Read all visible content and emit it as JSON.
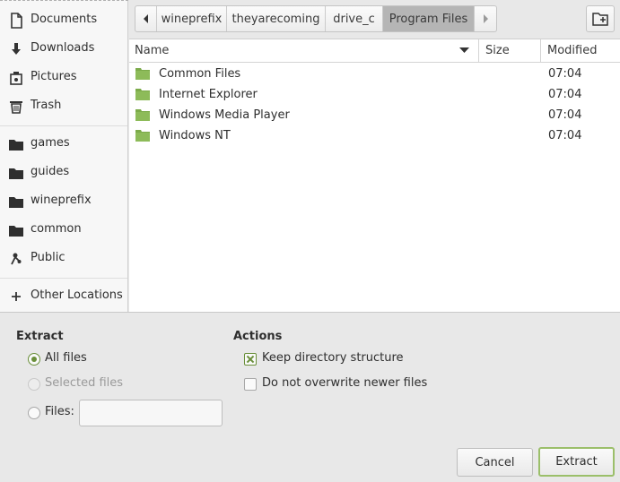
{
  "sidebar": {
    "places": [
      {
        "label": "Documents",
        "icon": "document-icon"
      },
      {
        "label": "Downloads",
        "icon": "download-icon"
      },
      {
        "label": "Pictures",
        "icon": "picture-icon"
      },
      {
        "label": "Trash",
        "icon": "trash-icon"
      }
    ],
    "bookmarks": [
      {
        "label": "games",
        "icon": "folder-icon"
      },
      {
        "label": "guides",
        "icon": "folder-icon"
      },
      {
        "label": "wineprefix",
        "icon": "folder-icon"
      },
      {
        "label": "common",
        "icon": "folder-icon"
      },
      {
        "label": "Public",
        "icon": "share-icon"
      }
    ],
    "other_locations": "Other Locations"
  },
  "pathbar": {
    "crumbs": [
      "wineprefix",
      "theyarecoming",
      "drive_c",
      "Program Files"
    ],
    "active": "Program Files"
  },
  "filelist": {
    "columns": {
      "name": "Name",
      "size": "Size",
      "modified": "Modified"
    },
    "rows": [
      {
        "name": "Common Files",
        "size": "",
        "modified": "07:04"
      },
      {
        "name": "Internet Explorer",
        "size": "",
        "modified": "07:04"
      },
      {
        "name": "Windows Media Player",
        "size": "",
        "modified": "07:04"
      },
      {
        "name": "Windows NT",
        "size": "",
        "modified": "07:04"
      }
    ]
  },
  "extract": {
    "title": "Extract",
    "all_files": "All files",
    "selected_files": "Selected files",
    "files": "Files:",
    "files_value": ""
  },
  "actions": {
    "title": "Actions",
    "keep_structure": "Keep directory structure",
    "no_overwrite": "Do not overwrite newer files"
  },
  "buttons": {
    "cancel": "Cancel",
    "extract": "Extract"
  },
  "colors": {
    "accent": "#6a8f3a",
    "folder": "#7cab4a",
    "active_crumb": "#b5b5b5"
  }
}
